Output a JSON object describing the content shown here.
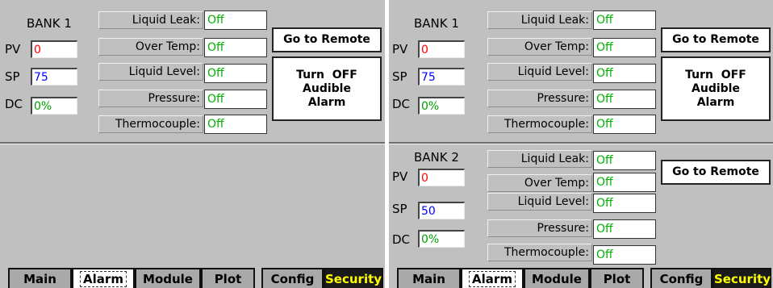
{
  "left": {
    "bank1": {
      "title": "BANK 1",
      "pv_label": "PV",
      "pv": "0",
      "sp_label": "SP",
      "sp": "75",
      "dc_label": "DC",
      "dc": "0%",
      "alarms": [
        {
          "label": "Liquid Leak:",
          "value": "Off"
        },
        {
          "label": "Over Temp:",
          "value": "Off"
        },
        {
          "label": "Liquid Level:",
          "value": "Off"
        },
        {
          "label": "Pressure:",
          "value": "Off"
        },
        {
          "label": "Thermocouple:",
          "value": "Off"
        }
      ],
      "remote_button": "Go to Remote",
      "audible_button": [
        "Turn  OFF",
        "Audible",
        "Alarm"
      ]
    }
  },
  "right": {
    "bank1": {
      "title": "BANK 1",
      "pv_label": "PV",
      "pv": "0",
      "sp_label": "SP",
      "sp": "75",
      "dc_label": "DC",
      "dc": "0%",
      "alarms": [
        {
          "label": "Liquid Leak:",
          "value": "Off"
        },
        {
          "label": "Over Temp:",
          "value": "Off"
        },
        {
          "label": "Liquid Level:",
          "value": "Off"
        },
        {
          "label": "Pressure:",
          "value": "Off"
        },
        {
          "label": "Thermocouple:",
          "value": "Off"
        }
      ],
      "remote_button": "Go to Remote",
      "audible_button": [
        "Turn  OFF",
        "Audible",
        "Alarm"
      ]
    },
    "bank2": {
      "title": "BANK 2",
      "pv_label": "PV",
      "pv": "0",
      "sp_label": "SP",
      "sp": "50",
      "dc_label": "DC",
      "dc": "0%",
      "alarms": [
        {
          "label": "Liquid Leak:",
          "value": "Off"
        },
        {
          "label": "Over Temp:",
          "value": "Off"
        },
        {
          "label": "Liquid Level:",
          "value": "Off"
        },
        {
          "label": "Pressure:",
          "value": "Off"
        },
        {
          "label": "Thermocouple:",
          "value": "Off"
        }
      ],
      "remote_button": "Go to Remote"
    }
  },
  "tabs": [
    "Main",
    "Alarm",
    "Module",
    "Plot",
    "Config",
    "Security"
  ],
  "colors": {
    "pv": "#ff0000",
    "sp": "#0000ff",
    "dc": "#00a000",
    "alarm_off": "#00b000",
    "security_tab_text": "#ffff00",
    "panel_bg": "#c0c0c0"
  }
}
